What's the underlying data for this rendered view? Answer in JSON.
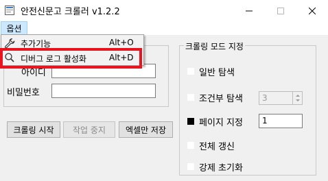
{
  "window": {
    "title": "안전신문고 크롤러 v1.2.2"
  },
  "menu": {
    "options_label": "옵션",
    "items": [
      {
        "label": "추가기능",
        "shortcut": "Alt+O",
        "icon": "wrench-icon"
      },
      {
        "label": "디버그 로그 활성화",
        "shortcut": "Alt+D",
        "icon": "search-icon"
      }
    ]
  },
  "login": {
    "id_label": "아이디",
    "id_value": "",
    "password_label": "비밀번호",
    "password_value": ""
  },
  "buttons": {
    "start": "크롤링 시작",
    "stop": "작업 중지",
    "excel": "엑셀만 저장"
  },
  "mode_group": {
    "title": "크롤링 모드 지정",
    "options": [
      {
        "label": "일반 탐색",
        "checked": false
      },
      {
        "label": "조건부 탐색",
        "checked": false
      },
      {
        "label": "페이지 지정",
        "checked": true
      },
      {
        "label": "전체 갱신",
        "checked": false
      },
      {
        "label": "강제 초기화",
        "checked": false
      }
    ],
    "condition_value": "3",
    "page_value": "1"
  },
  "colors": {
    "highlight": "#e8141e",
    "menu_selected": "#cce8ff"
  }
}
